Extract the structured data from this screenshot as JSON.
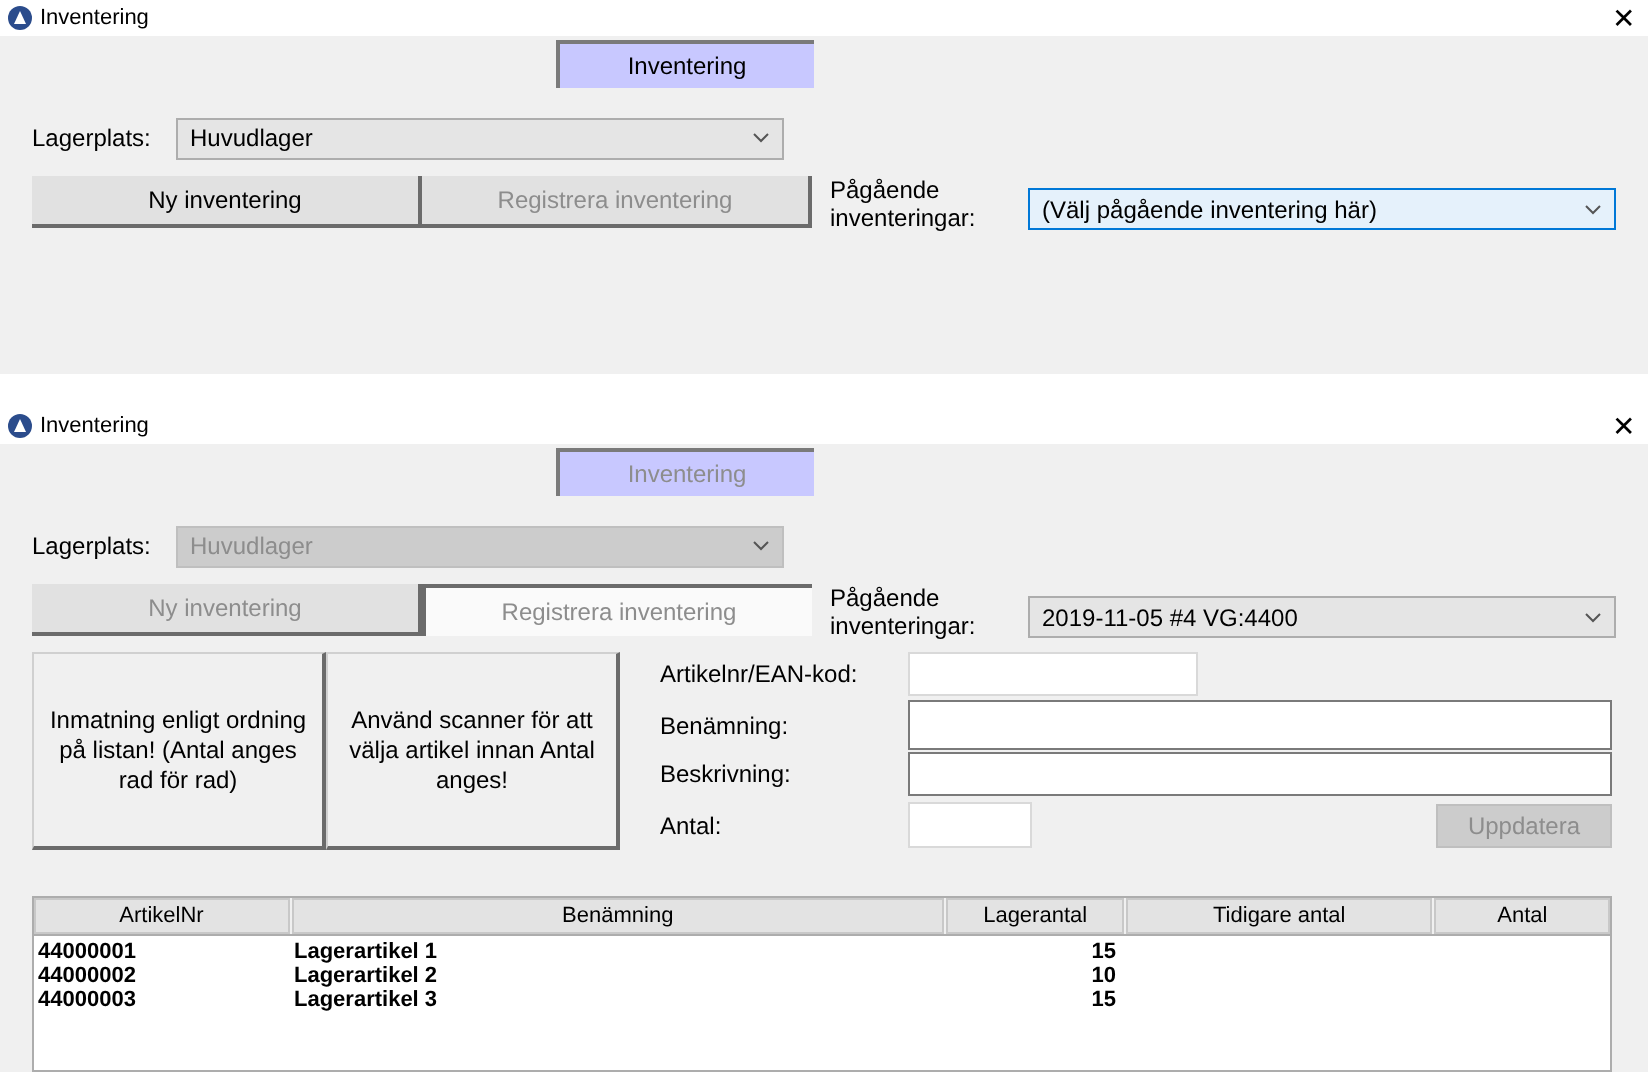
{
  "windows": [
    {
      "title": "Inventering",
      "close": "✕",
      "tab": {
        "label": "Inventering",
        "disabled": false
      },
      "lagerplats": {
        "label": "Lagerplats:",
        "value": "Huvudlager",
        "disabled": false
      },
      "mode_buttons": [
        {
          "label": "Ny inventering",
          "selected": false,
          "disabled": false
        },
        {
          "label": "Registrera inventering",
          "selected": false,
          "disabled": true
        }
      ],
      "pagaende": {
        "label": "Pågående inventeringar:",
        "value": "(Välj pågående inventering här)",
        "focused": true
      }
    },
    {
      "title": "Inventering",
      "close": "✕",
      "tab": {
        "label": "Inventering",
        "disabled": true
      },
      "lagerplats": {
        "label": "Lagerplats:",
        "value": "Huvudlager",
        "disabled": true
      },
      "mode_buttons": [
        {
          "label": "Ny inventering",
          "selected": false,
          "disabled": true
        },
        {
          "label": "Registrera inventering",
          "selected": true,
          "disabled": true
        }
      ],
      "pagaende": {
        "label": "Pågående inventeringar:",
        "value": "2019-11-05 #4 VG:4400",
        "focused": false
      },
      "entry_buttons": [
        "Inmatning enligt ordning på listan! (Antal anges rad för rad)",
        "Använd scanner för att välja artikel innan Antal anges!"
      ],
      "fields": [
        {
          "label": "Artikelnr/EAN-kod:"
        },
        {
          "label": "Benämning:"
        },
        {
          "label": "Beskrivning:"
        },
        {
          "label": "Antal:"
        }
      ],
      "update_button": {
        "label": "Uppdatera",
        "disabled": true
      },
      "table": {
        "columns": [
          "ArtikelNr",
          "Benämning",
          "Lagerantal",
          "Tidigare antal",
          "Antal"
        ],
        "rows": [
          [
            "44000001",
            "Lagerartikel 1",
            "15"
          ],
          [
            "44000002",
            "Lagerartikel 2",
            "10"
          ],
          [
            "44000003",
            "Lagerartikel 3",
            "15"
          ]
        ]
      }
    }
  ]
}
